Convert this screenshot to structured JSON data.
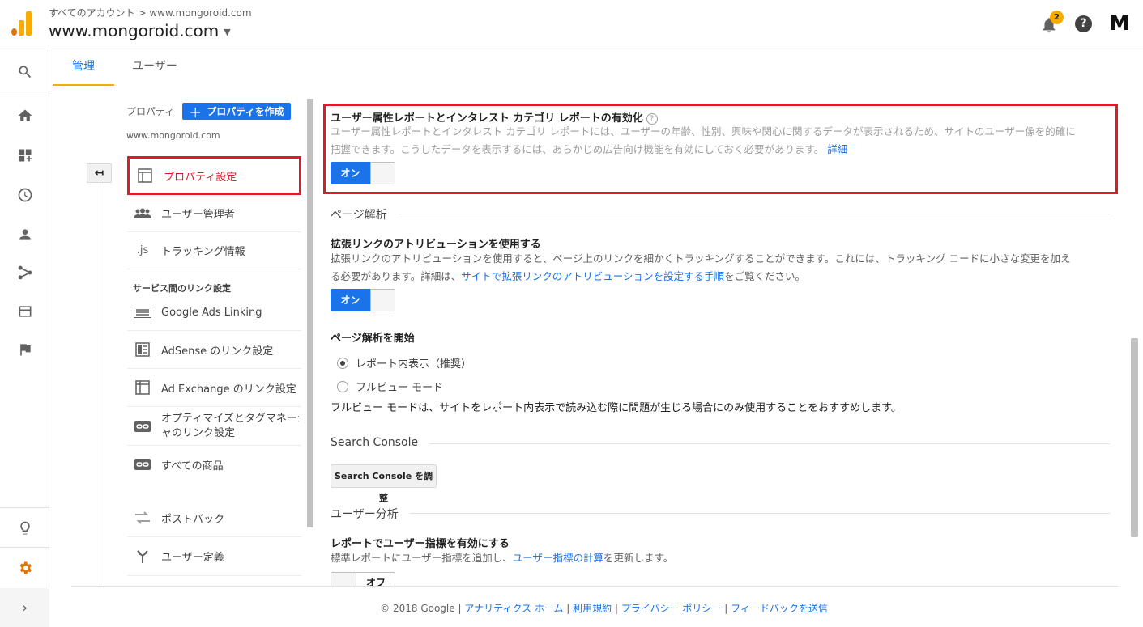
{
  "header": {
    "breadcrumb": "すべてのアカウント > www.mongoroid.com",
    "account": "www.mongoroid.com",
    "notification_count": "2",
    "help": "?",
    "avatar_initial": "M"
  },
  "tabs": [
    {
      "label": "管理",
      "active": true
    },
    {
      "label": "ユーザー",
      "active": false
    }
  ],
  "property": {
    "label": "プロパティ",
    "create_button": "プロパティを作成",
    "url": "www.mongoroid.com",
    "back": "↤"
  },
  "nav": {
    "items": [
      {
        "label": "プロパティ設定",
        "icon": "layout-icon",
        "selected": true
      },
      {
        "label": "ユーザー管理者",
        "icon": "users-icon"
      },
      {
        "label": "トラッキング情報",
        "icon": "js-icon"
      }
    ],
    "section_label": "サービス間のリンク設定",
    "link_items": [
      {
        "label": "Google Ads Linking",
        "icon": "ads-icon"
      },
      {
        "label": "AdSense のリンク設定",
        "icon": "adsense-icon"
      },
      {
        "label": "Ad Exchange のリンク設定",
        "icon": "adx-icon"
      },
      {
        "label_line1": "オプティマイズとタグマネージ",
        "label_line2": "ャのリンク設定",
        "icon": "link-icon"
      },
      {
        "label": "すべての商品",
        "icon": "link-icon"
      }
    ],
    "extra_items": [
      {
        "label": "ポストバック",
        "icon": "postback-icon"
      },
      {
        "label": "ユーザー定義",
        "icon": "custom-definition-icon"
      }
    ]
  },
  "demographics": {
    "title": "ユーザー属性レポートとインタレスト カテゴリ レポートの有効化",
    "help": "?",
    "desc_line1": "ユーザー属性レポートとインタレスト カテゴリ レポートには、ユーザーの年齢、性別、興味や関心に関するデータが表示されるため、サイトのユーザー像を的確に",
    "desc_line2": "把握できます。こうしたデータを表示するには、あらかじめ広告向け機能を有効にしておく必要があります。",
    "desc_link": "詳細",
    "toggle": "オン"
  },
  "page_analytics": {
    "section": "ページ解析",
    "enhanced_title": "拡張リンクのアトリビューションを使用する",
    "enhanced_desc_line1": "拡張リンクのアトリビューションを使用すると、ページ上のリンクを細かくトラッキングすることができます。これには、トラッキング コードに小さな変更を加え",
    "enhanced_desc_line2_pre": "る必要があります。詳細は、",
    "enhanced_desc_link": "サイトで拡張リンクのアトリビューションを設定する手順",
    "enhanced_desc_line2_post": "をご覧ください。",
    "toggle": "オン",
    "start_label": "ページ解析を開始",
    "options": [
      {
        "label": "レポート内表示（推奨）",
        "selected": true
      },
      {
        "label": "フルビュー モード",
        "selected": false
      }
    ],
    "note": "フルビュー モードは、サイトをレポート内表示で読み込む際に問題が生じる場合にのみ使用することをおすすめします。"
  },
  "search_console": {
    "section": "Search Console",
    "button": "Search Console を調整"
  },
  "user_analysis": {
    "section": "ユーザー分析",
    "title": "レポートでユーザー指標を有効にする",
    "desc_pre": "標準レポートにユーザー指標を追加し、",
    "desc_link": "ユーザー指標の計算",
    "desc_post": "を更新します。",
    "toggle": "オフ"
  },
  "footer": {
    "copyright": "© 2018 Google |",
    "links": [
      "アナリティクス ホーム",
      "利用規約",
      "プライバシー ポリシー",
      "フィードバックを送信"
    ]
  },
  "colors": {
    "accent": "#1a73e8",
    "highlight_red": "#d91e2a",
    "tab_underline": "#f9ab00",
    "logo_orange": "#f9ab00",
    "settings_gear": "#e37400"
  }
}
